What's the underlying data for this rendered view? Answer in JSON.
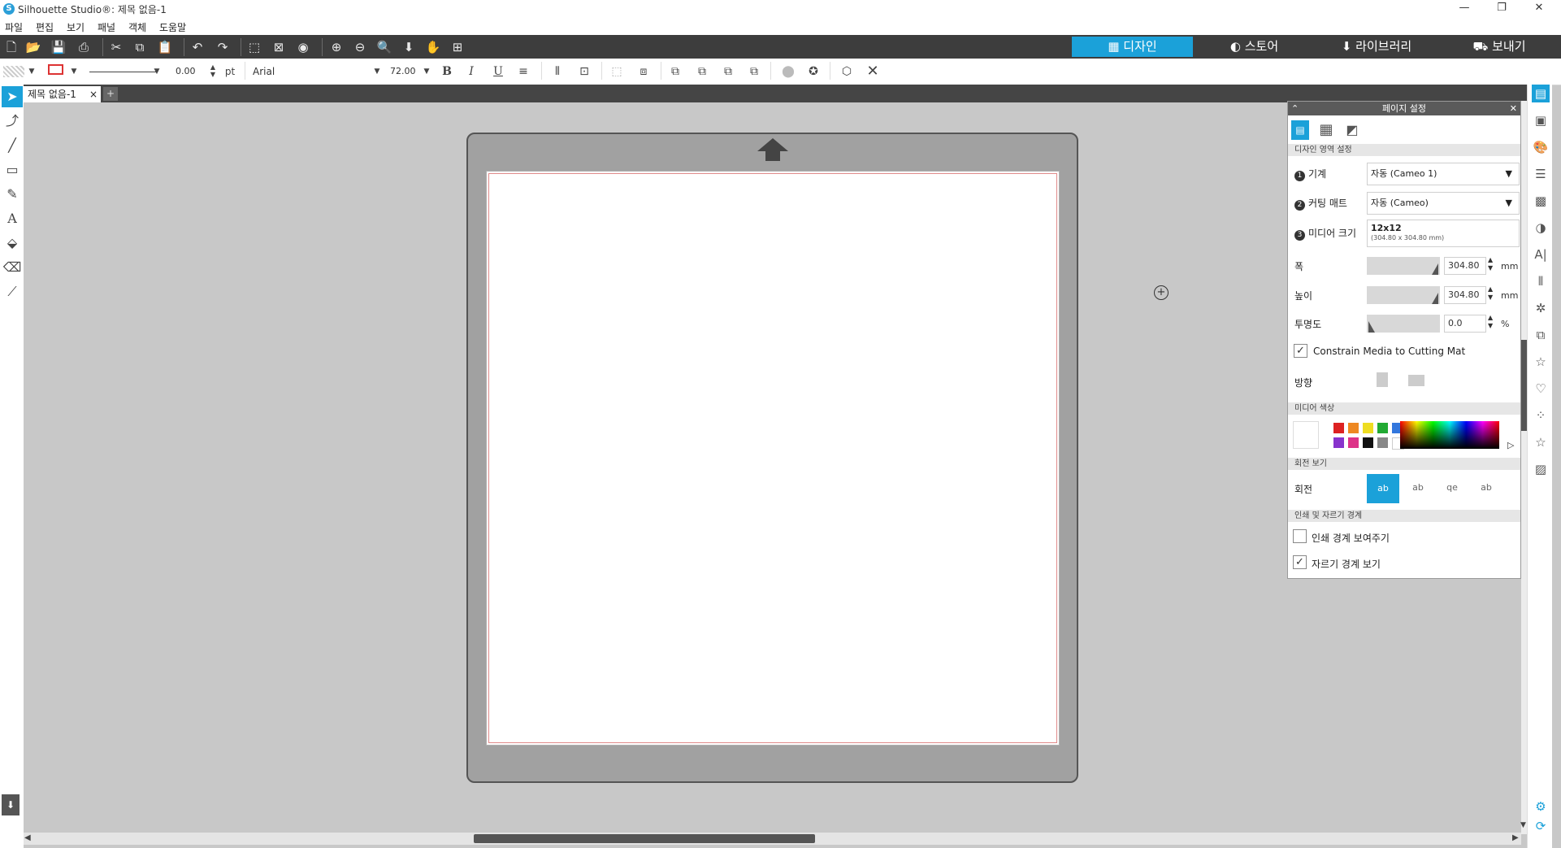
{
  "window": {
    "title": "Silhouette Studio®: 제목 없음-1",
    "controls": [
      "—",
      "❐",
      "✕"
    ]
  },
  "menu": [
    "파일",
    "편집",
    "보기",
    "패널",
    "객체",
    "도움말"
  ],
  "nav_tabs": [
    {
      "label": "디자인",
      "icon": "grid-icon",
      "active": true
    },
    {
      "label": "스토어",
      "icon": "store-icon",
      "active": false
    },
    {
      "label": "라이브러리",
      "icon": "library-icon",
      "active": false
    },
    {
      "label": "보내기",
      "icon": "send-icon",
      "active": false
    }
  ],
  "colors": {
    "accent": "#1ba1d9",
    "toolbar": "#3d3d3d",
    "cutline": "#e08a8a"
  },
  "line_options": {
    "width_value": "0.00",
    "width_unit": "pt"
  },
  "text_options": {
    "font_name": "Arial",
    "font_size": "72.00",
    "bold": "B",
    "italic": "I",
    "underline": "U"
  },
  "document": {
    "tab_label": "제목 없음-1",
    "close": "×",
    "add": "+"
  },
  "panel": {
    "title": "페이지 설정",
    "sections": {
      "design_area": "디자인 영역 설정",
      "media_color": "미디어 색상",
      "rotate_view": "회전 보기",
      "print_cut": "인쇄 및 자르기 경계"
    },
    "machine": {
      "step": "1",
      "label": "기계",
      "value": "자동 (Cameo 1)"
    },
    "mat": {
      "step": "2",
      "label": "커팅 매트",
      "value": "자동 (Cameo)"
    },
    "media": {
      "step": "3",
      "label": "미디어 크기",
      "value": "12x12",
      "sub": "(304.80 x 304.80 mm)"
    },
    "width": {
      "label": "폭",
      "value": "304.80",
      "unit": "mm"
    },
    "height": {
      "label": "높이",
      "value": "304.80",
      "unit": "mm"
    },
    "opacity": {
      "label": "투명도",
      "value": "0.0",
      "unit": "%"
    },
    "constrain": {
      "label": "Constrain Media to Cutting Mat",
      "checked": true
    },
    "orientation_label": "방향",
    "rotate_label": "회전",
    "show_print_border": {
      "label": "인쇄 경계 보여주기",
      "checked": false
    },
    "show_cut_border": {
      "label": "자르기 경계 보기",
      "checked": true
    }
  },
  "swatches": [
    "#dd2222",
    "#ee8822",
    "#eedd22",
    "#22aa33",
    "#3377dd",
    "#8833cc",
    "#dd3388",
    "#111111",
    "#888888",
    "#ffffff"
  ]
}
